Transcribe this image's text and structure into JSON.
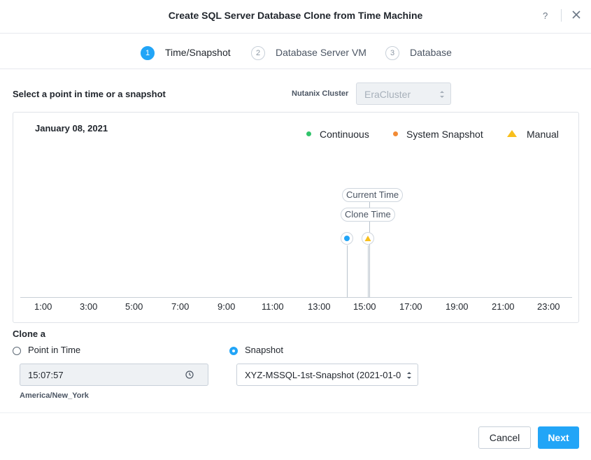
{
  "dialog": {
    "title": "Create SQL Server Database Clone from Time Machine",
    "help": "?"
  },
  "steps": [
    {
      "number": "1",
      "label": "Time/Snapshot"
    },
    {
      "number": "2",
      "label": "Database Server VM"
    },
    {
      "number": "3",
      "label": "Database"
    }
  ],
  "selection": {
    "heading": "Select a point in time or a snapshot",
    "cluster_label": "Nutanix Cluster",
    "cluster_value": "EraCluster"
  },
  "timeline": {
    "date": "January 08, 2021",
    "legend": [
      {
        "label": "Continuous",
        "color": "#31c46b",
        "shape": "circle"
      },
      {
        "label": "System Snapshot",
        "color": "#f28b35",
        "shape": "circle"
      },
      {
        "label": "Manual",
        "color": "#f8bf1c",
        "shape": "triangle"
      }
    ],
    "ticks": [
      "1:00",
      "3:00",
      "5:00",
      "7:00",
      "9:00",
      "11:00",
      "13:00",
      "15:00",
      "17:00",
      "19:00",
      "21:00",
      "23:00"
    ],
    "current_time_label": "Current Time",
    "clone_time_label": "Clone Time",
    "continuous_marker_color": "#22a5f7",
    "manual_marker_color": "#f8bf1c"
  },
  "clone": {
    "heading": "Clone a",
    "options": [
      {
        "label": "Point in Time",
        "selected": false
      },
      {
        "label": "Snapshot",
        "selected": true
      }
    ],
    "time_value": "15:07:57",
    "timezone": "America/New_York",
    "snapshot_value": "XYZ-MSSQL-1st-Snapshot (2021-01-0"
  },
  "footer": {
    "cancel_label": "Cancel",
    "next_label": "Next"
  },
  "colors": {
    "accent": "#22a5f7",
    "text": "#22272e"
  }
}
